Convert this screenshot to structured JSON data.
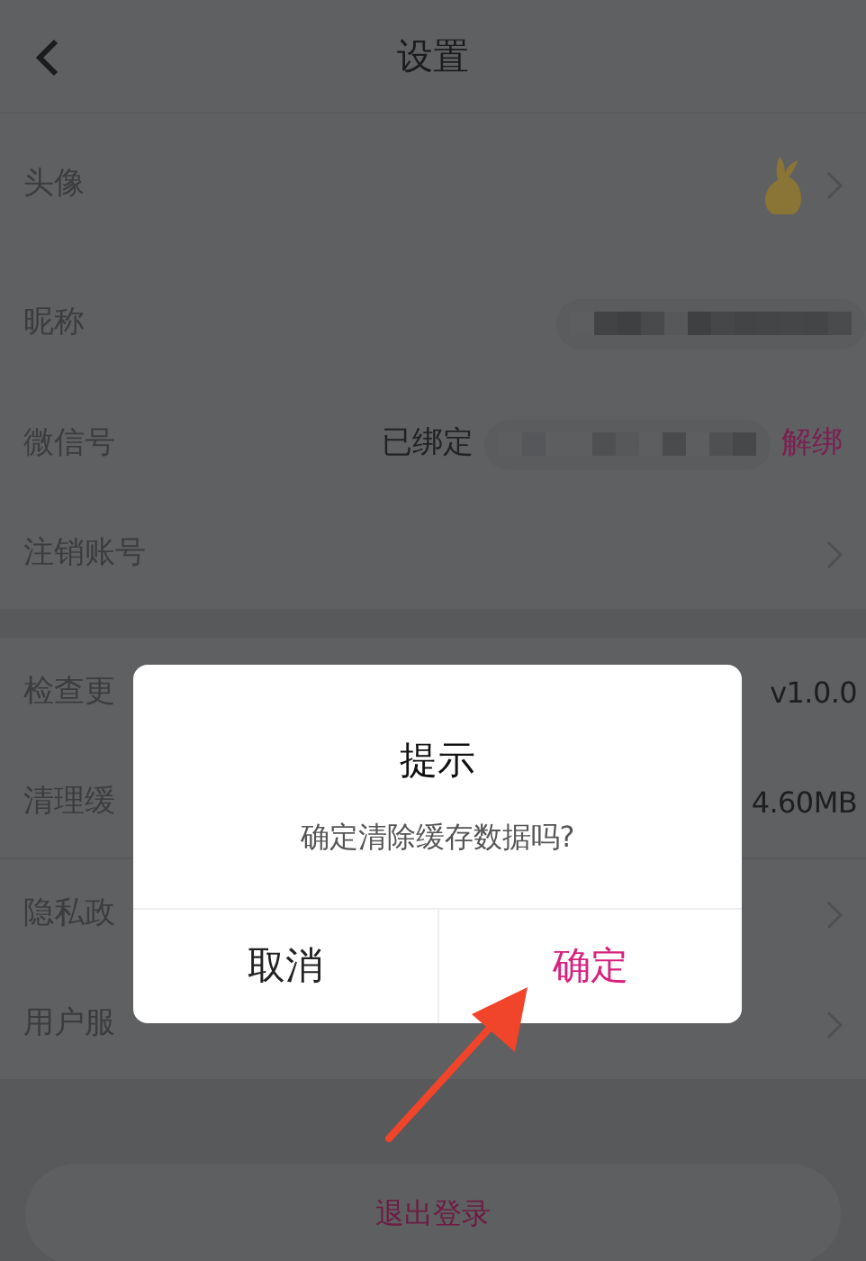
{
  "header": {
    "title": "设置"
  },
  "sections": [
    {
      "rows": [
        {
          "kind": "avatar",
          "label": "头像"
        },
        {
          "kind": "redacted",
          "label": "昵称"
        },
        {
          "kind": "binding",
          "label": "微信号",
          "status": "已绑定",
          "action": "解绑"
        },
        {
          "kind": "link",
          "label": "注销账号"
        }
      ]
    },
    {
      "rows": [
        {
          "kind": "value",
          "label": "检查更",
          "value": "v1.0.0"
        },
        {
          "kind": "value",
          "label": "清理缓",
          "value": "4.60MB"
        }
      ]
    },
    {
      "rows": [
        {
          "kind": "link",
          "label": "隐私政"
        },
        {
          "kind": "link",
          "label": "用户服"
        }
      ]
    }
  ],
  "logout_button": "退出登录",
  "dialog": {
    "title": "提示",
    "message": "确定清除缓存数据吗?",
    "buttons": [
      {
        "kind": "cancel",
        "label": "取消"
      },
      {
        "kind": "confirm",
        "label": "确定"
      }
    ]
  }
}
